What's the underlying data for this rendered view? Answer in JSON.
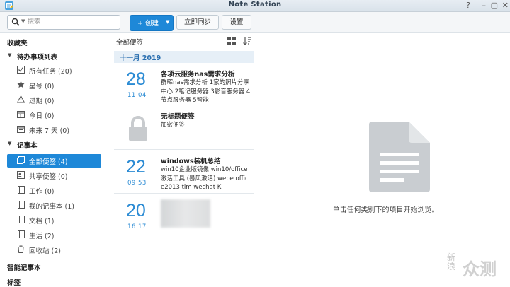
{
  "window": {
    "title": "Note Station",
    "controls": {
      "help": "?",
      "minimize": "–",
      "maximize": "▢",
      "close": "✕"
    }
  },
  "toolbar": {
    "search_placeholder": "搜索",
    "create_label": "+ 创建",
    "sync_label": "立即同步",
    "settings_label": "设置"
  },
  "sidebar": {
    "favorites": "收藏夹",
    "todo_group": "待办事项列表",
    "todo_items": [
      "所有任务 (20)",
      "星号 (0)",
      "过期 (0)",
      "今日 (0)",
      "未来 7 天 (0)"
    ],
    "notebook_group": "记事本",
    "notebook_items": [
      "全部便签 (4)",
      "共享便签 (0)",
      "工作 (0)",
      "我的记事本 (1)",
      "文档 (1)",
      "生活 (2)",
      "回收站 (2)"
    ],
    "selected": "全部便签 (4)",
    "smart_notebook": "智能记事本",
    "tags": "标签"
  },
  "note_list": {
    "title": "全部便签",
    "month": "十一月 2019",
    "notes": [
      {
        "day": "28",
        "time": "11  04",
        "title": "各项云服务nas需求分析",
        "body": "群晖nas需求分析 1家的照片分享中心 2笔记服务器 3影音服务器 4节点服务器 5智能"
      },
      {
        "title": "无标题便签",
        "body": "加密便签",
        "locked": true
      },
      {
        "day": "22",
        "time": "09  53",
        "title": "windows装机总结",
        "body": "win10企业版镜像 win10/office激活工具 (暴风激活) wepe office2013 tim wechat K"
      },
      {
        "day": "20",
        "time": "16  17",
        "title": "",
        "body": "",
        "blurred": true
      }
    ]
  },
  "main": {
    "empty_text": "单击任何类别下的项目开始浏览。"
  },
  "watermark": {
    "small": "新\n浪",
    "large": "众测"
  },
  "colors": {
    "accent": "#1e88d8",
    "date_blue": "#2b8bd4"
  }
}
